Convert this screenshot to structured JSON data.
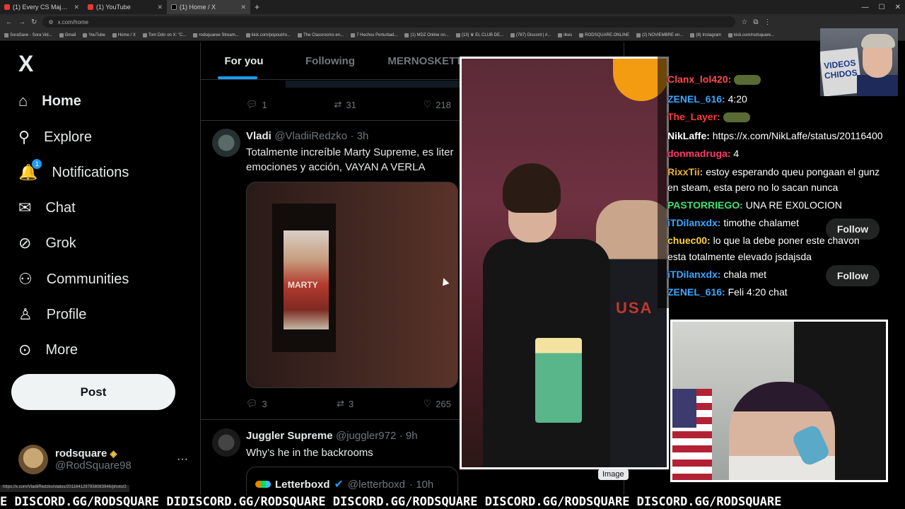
{
  "browser": {
    "tabs": [
      {
        "title": "(1) Every CS Major Winning Mi",
        "active": false
      },
      {
        "title": "(1) YouTube",
        "active": false
      },
      {
        "title": "(1) Home / X",
        "active": true
      }
    ],
    "new_tab_symbol": "+",
    "url": "x.com/home",
    "bookmarks": [
      "SoraSave - Sora Vid...",
      "Gmail",
      "YouTube",
      "Home / X",
      "Tom Ddrr on X: \"C...",
      "rodsquaree Stream...",
      "kick.com/popout/ro...",
      "The Classrooms en...",
      "7 Hechos Perturbad...",
      "(1) MDZ Online on...",
      "(13) ♛ EL CLUB DE...",
      "(787) Discord | #...",
      "likes",
      "RODSQUARE.ONLINE",
      "(2) NOVIEMBRE en...",
      "(8) Instagram",
      "kick.com/rodsquare..."
    ],
    "status_url": "https://x.com/VladiiRedzko/status/2011641297938083946/photo/2"
  },
  "nav": {
    "logo": "X",
    "items": [
      {
        "label": "Home",
        "icon": "home-icon",
        "glyph": "⌂"
      },
      {
        "label": "Explore",
        "icon": "search-icon",
        "glyph": "⚲"
      },
      {
        "label": "Notifications",
        "icon": "bell-icon",
        "glyph": "🔔",
        "badge": "1"
      },
      {
        "label": "Chat",
        "icon": "mail-icon",
        "glyph": "✉"
      },
      {
        "label": "Grok",
        "icon": "grok-icon",
        "glyph": "⊘"
      },
      {
        "label": "Communities",
        "icon": "communities-icon",
        "glyph": "⚇"
      },
      {
        "label": "Profile",
        "icon": "person-icon",
        "glyph": "♙"
      },
      {
        "label": "More",
        "icon": "more-circle-icon",
        "glyph": "⊙"
      }
    ],
    "post_label": "Post",
    "account": {
      "name": "rodsquare",
      "handle": "@RodSquare98",
      "more": "···"
    }
  },
  "feed": {
    "tabs": [
      "For you",
      "Following",
      "MERNOSKETTI"
    ],
    "prev_tweet_actions": {
      "replies": "1",
      "reposts": "31",
      "likes": "218"
    },
    "tweet1": {
      "name": "Vladi",
      "handle": "@VladiiRedzko",
      "time": "· 3h",
      "text": "Totalmente increíble Marty Supreme, es liter emociones y acción, VAYAN A VERLA",
      "poster_title": "MARTY",
      "actions": {
        "replies": "3",
        "reposts": "3",
        "likes": "265"
      }
    },
    "tweet2": {
      "name": "Juggler Supreme",
      "handle": "@juggler972",
      "time": "· 9h",
      "text": "Why’s he in the backrooms"
    },
    "quote": {
      "name": "Letterboxd",
      "handle": "@letterboxd",
      "time": "· 10h"
    }
  },
  "overlay": {
    "image_badge": "Image",
    "chat": [
      {
        "user": "Clanx_lol420:",
        "msg": "",
        "color": "#ff4a4a",
        "emote": true
      },
      {
        "user": "ZENEL_616:",
        "msg": "4:20",
        "color": "#3da6ff"
      },
      {
        "user": "The_Layer:",
        "msg": "",
        "color": "#ff3b3b",
        "emote": true
      },
      {
        "user": "NikLaffe:",
        "msg": "https://x.com/NikLaffe/status/20116400",
        "color": "#ffffff"
      },
      {
        "user": "donmadruga:",
        "msg": "4",
        "color": "#ff3b6b"
      },
      {
        "user": "RixxTii:",
        "msg": "estoy esperando queu pongaan el gunz",
        "color": "#f0b030"
      },
      {
        "user": "",
        "msg": "en steam, esta pero no lo sacan nunca",
        "color": "#ffffff"
      },
      {
        "user": "PASTORRIEGO:",
        "msg": "UNA RE EX0LOCION",
        "color": "#40e070"
      },
      {
        "user": "iTDilanxdx:",
        "msg": "timothe chalamet",
        "color": "#3da6ff"
      },
      {
        "user": "chuec00:",
        "msg": "lo que la debe poner este chavon",
        "color": "#ffd23a"
      },
      {
        "user": "",
        "msg": "esta totalmente elevado jsdajsda",
        "color": "#ffffff"
      },
      {
        "user": "iTDilanxdx:",
        "msg": "chala met",
        "color": "#3da6ff"
      },
      {
        "user": "ZENEL_616:",
        "msg": "Feli 4:20 chat",
        "color": "#3da6ff"
      }
    ],
    "follow_label": "Follow",
    "corner_sign": "VIDEOS CHIDOS",
    "ticker": "E DISCORD.GG/RODSQUARE DIDISCORD.GG/RODSQUARE DISCORD.GG/RODSQUARE DISCORD.GG/RODSQUARE DISCORD.GG/RODSQUARE"
  }
}
